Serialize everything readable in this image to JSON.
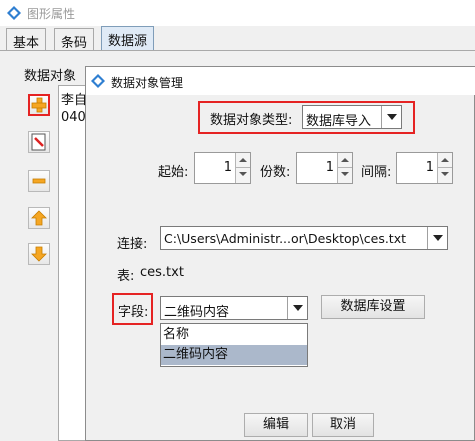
{
  "window": {
    "title": "图形属性"
  },
  "tabs": [
    {
      "label": "基本"
    },
    {
      "label": "条码"
    },
    {
      "label": "数据源"
    }
  ],
  "panel": {
    "label": "数据对象",
    "list_items": [
      "李自",
      "040"
    ]
  },
  "tools": [
    "add-icon",
    "edit-icon",
    "remove-icon",
    "move-up-icon",
    "move-down-icon"
  ],
  "dialog": {
    "title": "数据对象管理",
    "type_label": "数据对象类型:",
    "type_value": "数据库导入",
    "start_label": "起始:",
    "start_value": "1",
    "copies_label": "份数:",
    "copies_value": "1",
    "interval_label": "间隔:",
    "interval_value": "1",
    "connect_label": "连接:",
    "connect_value": "C:\\Users\\Administr...or\\Desktop\\ces.txt",
    "table_label": "表:",
    "table_value": "ces.txt",
    "field_label": "字段:",
    "field_value": "二维码内容",
    "db_settings_label": "数据库设置",
    "field_options": [
      "名称",
      "二维码内容"
    ],
    "field_selected_index": 1,
    "edit_label": "编辑",
    "cancel_label": "取消"
  },
  "colors": {
    "highlight_red": "#e52323",
    "selection_blue": "#abb8cb",
    "active_tab": "#dfeaf6"
  }
}
